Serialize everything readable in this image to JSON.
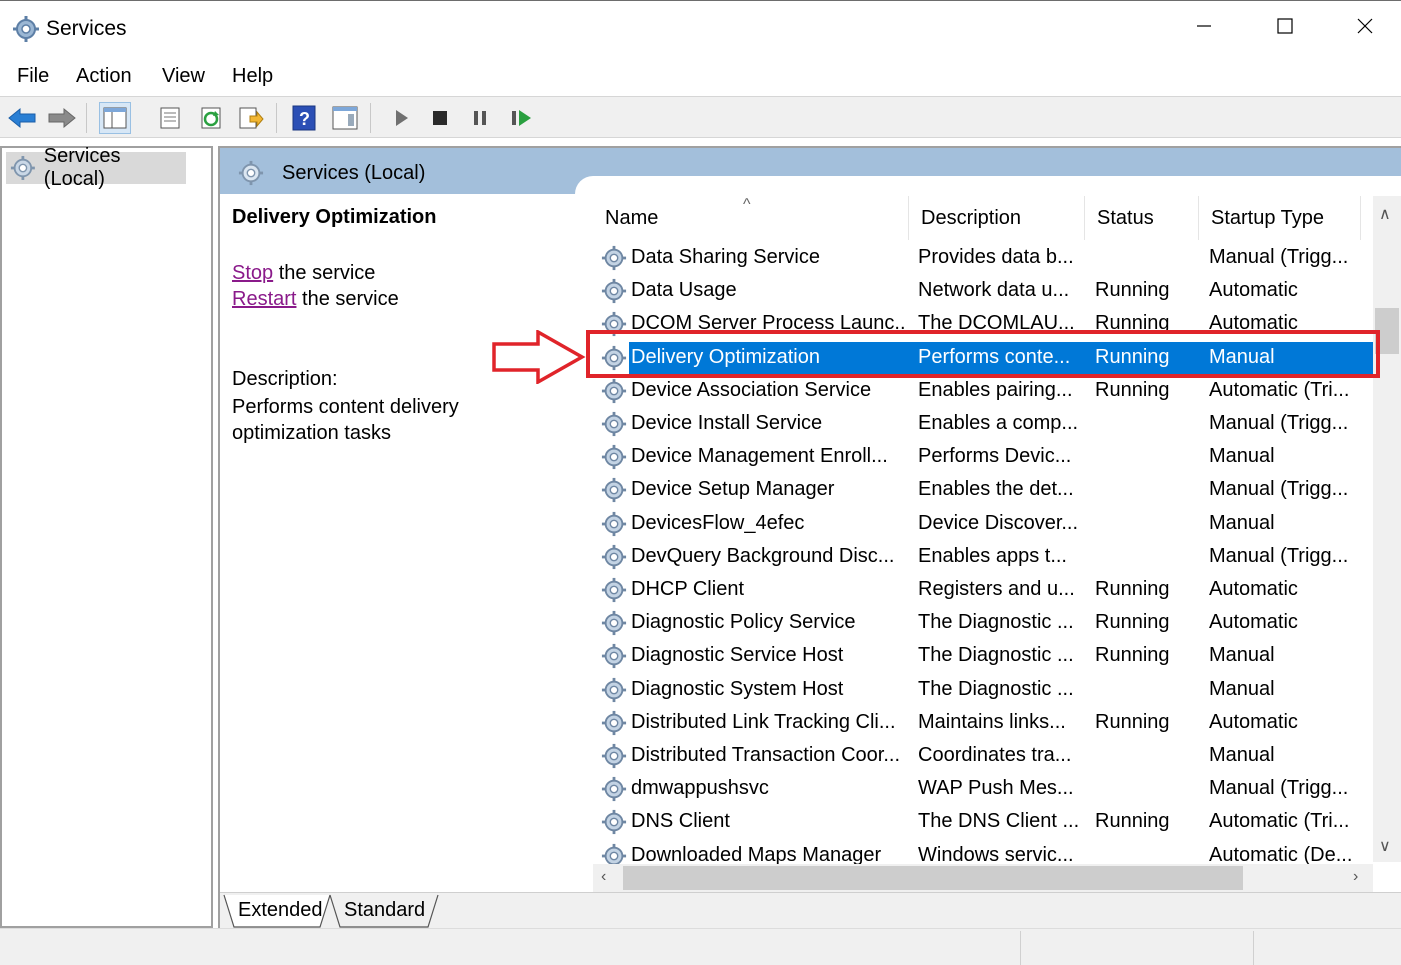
{
  "window": {
    "title": "Services"
  },
  "menu": [
    "File",
    "Action",
    "View",
    "Help"
  ],
  "tree": {
    "root_label": "Services (Local)"
  },
  "pane_header": "Services (Local)",
  "details": {
    "service_name": "Delivery Optimization",
    "stop_link": "Stop",
    "stop_rest": " the service",
    "restart_link": "Restart",
    "restart_rest": " the service",
    "description_label": "Description:",
    "description_text": "Performs content delivery optimization tasks"
  },
  "table": {
    "columns": [
      "Name",
      "Description",
      "Status",
      "Startup Type"
    ],
    "rows": [
      {
        "name": "Data Sharing Service",
        "description": "Provides data b...",
        "status": "",
        "startup": "Manual (Trigg..."
      },
      {
        "name": "Data Usage",
        "description": "Network data u...",
        "status": "Running",
        "startup": "Automatic"
      },
      {
        "name": "DCOM Server Process Launc...",
        "description": "The DCOMLAU...",
        "status": "Running",
        "startup": "Automatic"
      },
      {
        "name": "Delivery Optimization",
        "description": "Performs conte...",
        "status": "Running",
        "startup": "Manual",
        "selected": true
      },
      {
        "name": "Device Association Service",
        "description": "Enables pairing...",
        "status": "Running",
        "startup": "Automatic (Tri..."
      },
      {
        "name": "Device Install Service",
        "description": "Enables a comp...",
        "status": "",
        "startup": "Manual (Trigg..."
      },
      {
        "name": "Device Management Enroll...",
        "description": "Performs Devic...",
        "status": "",
        "startup": "Manual"
      },
      {
        "name": "Device Setup Manager",
        "description": "Enables the det...",
        "status": "",
        "startup": "Manual (Trigg..."
      },
      {
        "name": "DevicesFlow_4efec",
        "description": "Device Discover...",
        "status": "",
        "startup": "Manual"
      },
      {
        "name": "DevQuery Background Disc...",
        "description": "Enables apps t...",
        "status": "",
        "startup": "Manual (Trigg..."
      },
      {
        "name": "DHCP Client",
        "description": "Registers and u...",
        "status": "Running",
        "startup": "Automatic"
      },
      {
        "name": "Diagnostic Policy Service",
        "description": "The Diagnostic ...",
        "status": "Running",
        "startup": "Automatic"
      },
      {
        "name": "Diagnostic Service Host",
        "description": "The Diagnostic ...",
        "status": "Running",
        "startup": "Manual"
      },
      {
        "name": "Diagnostic System Host",
        "description": "The Diagnostic ...",
        "status": "",
        "startup": "Manual"
      },
      {
        "name": "Distributed Link Tracking Cli...",
        "description": "Maintains links...",
        "status": "Running",
        "startup": "Automatic"
      },
      {
        "name": "Distributed Transaction Coor...",
        "description": "Coordinates tra...",
        "status": "",
        "startup": "Manual"
      },
      {
        "name": "dmwappushsvc",
        "description": "WAP Push Mes...",
        "status": "",
        "startup": "Manual (Trigg..."
      },
      {
        "name": "DNS Client",
        "description": "The DNS Client ...",
        "status": "Running",
        "startup": "Automatic (Tri..."
      },
      {
        "name": "Downloaded Maps Manager",
        "description": "Windows servic...",
        "status": "",
        "startup": "Automatic (De..."
      }
    ]
  },
  "view_tabs": [
    "Extended",
    "Standard"
  ],
  "colors": {
    "selection": "#0078d7",
    "header_band": "#a3bfdb",
    "annotation": "#e0242a",
    "link": "#8a1a8a"
  }
}
